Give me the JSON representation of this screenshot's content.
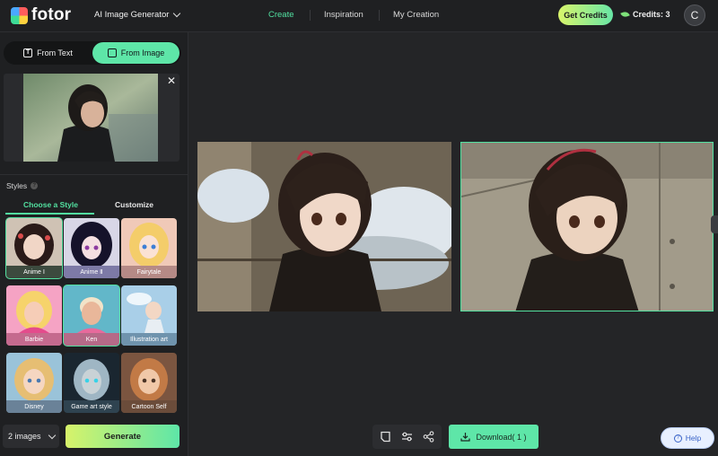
{
  "header": {
    "logo_text": "fotor",
    "product_label": "AI Image Generator",
    "nav": [
      "Create",
      "Inspiration",
      "My Creation"
    ],
    "get_credits": "Get Credits",
    "credits_text": "Credits: 3",
    "avatar_initial": "C"
  },
  "left_panel": {
    "tabs": {
      "from_text": "From Text",
      "from_image": "From Image"
    },
    "styles_label": "Styles",
    "style_tabs": {
      "choose": "Choose a Style",
      "customize": "Customize"
    },
    "styles": [
      "Anime Ⅰ",
      "Anime Ⅱ",
      "Fairytale",
      "Barbie",
      "Ken",
      "Illustration art",
      "Disney",
      "Game art style",
      "Cartoon Self"
    ],
    "selected_style": "Anime Ⅰ",
    "image_count": "2 images",
    "generate_label": "Generate"
  },
  "main": {
    "download_label": "Download",
    "download_count": "( 1 )",
    "help_label": "Help"
  },
  "colors": {
    "accent": "#52e0a0",
    "background": "#242527",
    "panel": "#1f2022"
  }
}
